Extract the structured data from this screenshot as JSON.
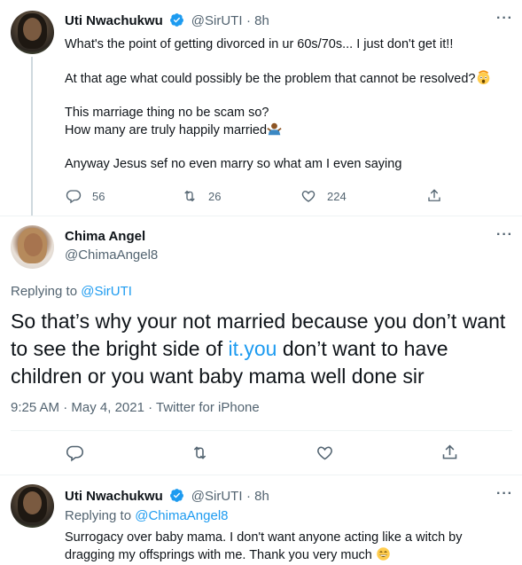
{
  "tweet1": {
    "name": "Uti Nwachukwu",
    "handle": "@SirUTI",
    "time": "· 8h",
    "lines": [
      "What's the point of getting divorced in ur 60s/70s... I just don't get it!!",
      "At that age what could possibly be the problem that cannot be resolved?",
      "This marriage thing no be scam so?",
      "How many are truly happily married",
      "Anyway Jesus sef no even marry so what am I even saying"
    ],
    "replies": "56",
    "retweets": "26",
    "likes": "224"
  },
  "tweet2": {
    "name": "Chima Angel",
    "handle": "@ChimaAngel8",
    "replying_prefix": "Replying to ",
    "replying_to": "@SirUTI",
    "text_before": "So that’s why your not married because you don’t want to see the bright side of ",
    "link_text": "it.you",
    "text_after": " don’t want to have children or you want baby mama well done sir",
    "time": "9:25 AM",
    "date": "May 4, 2021",
    "source": "Twitter for iPhone",
    "sep1": " · ",
    "sep2": " · "
  },
  "tweet3": {
    "name": "Uti Nwachukwu",
    "handle": "@SirUTI",
    "time": "· 8h",
    "replying_prefix": "Replying to ",
    "replying_to": "@ChimaAngel8",
    "line1": "Surrogacy over baby mama. I don't want anyone acting like a witch by",
    "line2": "dragging my offsprings with me.  Thank you very much"
  },
  "icons": {
    "reply": "reply-icon",
    "retweet": "retweet-icon",
    "like": "heart-icon",
    "share": "share-icon",
    "more": "more-icon",
    "verified": "verified-badge-icon"
  },
  "colors": {
    "accent": "#1d9bf0",
    "secondary": "#536471",
    "divider": "#eff3f4"
  }
}
